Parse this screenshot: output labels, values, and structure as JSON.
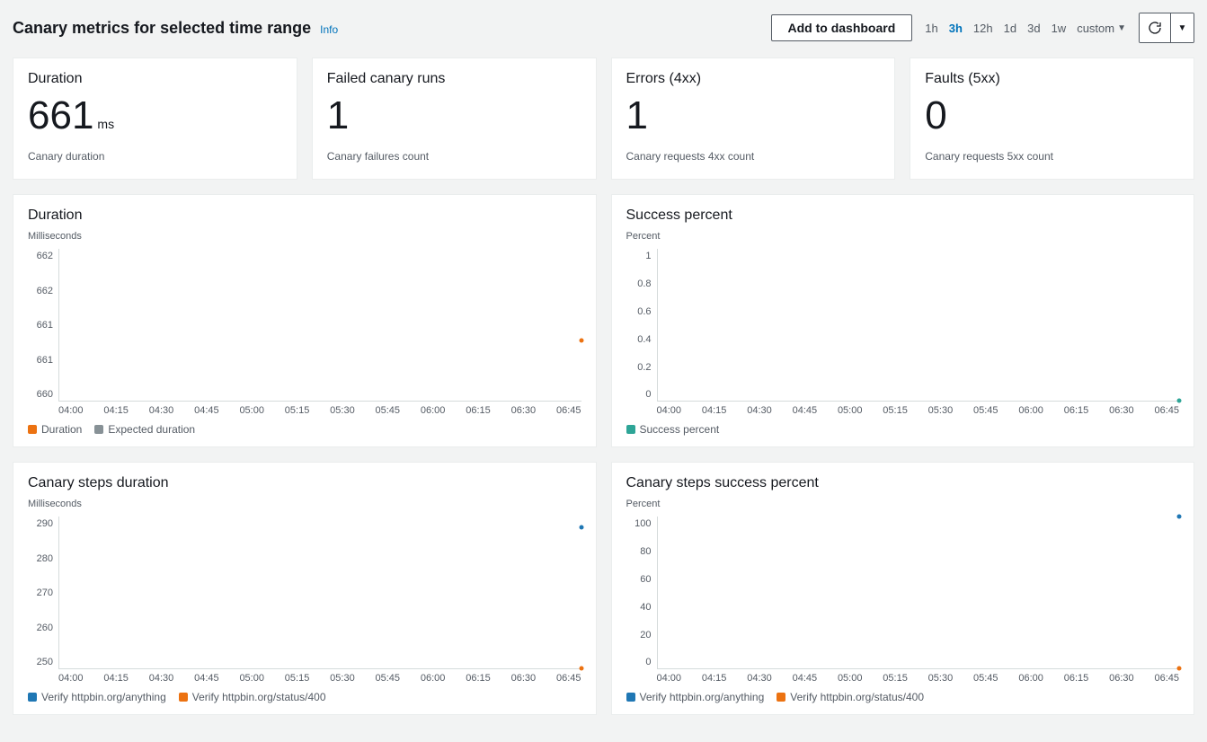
{
  "header": {
    "title": "Canary metrics for selected time range",
    "info": "Info",
    "add_dashboard": "Add to dashboard",
    "ranges": [
      "1h",
      "3h",
      "12h",
      "1d",
      "3d",
      "1w"
    ],
    "active_range": "3h",
    "custom": "custom"
  },
  "stats": [
    {
      "title": "Duration",
      "value": "661",
      "unit": "ms",
      "desc": "Canary duration"
    },
    {
      "title": "Failed canary runs",
      "value": "1",
      "unit": "",
      "desc": "Canary failures count"
    },
    {
      "title": "Errors (4xx)",
      "value": "1",
      "unit": "",
      "desc": "Canary requests 4xx count"
    },
    {
      "title": "Faults (5xx)",
      "value": "0",
      "unit": "",
      "desc": "Canary requests 5xx count"
    }
  ],
  "x_ticks": [
    "04:00",
    "04:15",
    "04:30",
    "04:45",
    "05:00",
    "05:15",
    "05:30",
    "05:45",
    "06:00",
    "06:15",
    "06:30",
    "06:45"
  ],
  "colors": {
    "orange": "#ec7211",
    "grey": "#879196",
    "teal": "#2ea597",
    "blue": "#1f77b4"
  },
  "charts": {
    "duration": {
      "title": "Duration",
      "ylabel": "Milliseconds",
      "yticks": [
        "662",
        "662",
        "661",
        "661",
        "660"
      ],
      "legend": [
        {
          "label": "Duration",
          "color": "orange"
        },
        {
          "label": "Expected duration",
          "color": "grey"
        }
      ]
    },
    "success": {
      "title": "Success percent",
      "ylabel": "Percent",
      "yticks": [
        "1",
        "0.8",
        "0.6",
        "0.4",
        "0.2",
        "0"
      ],
      "legend": [
        {
          "label": "Success percent",
          "color": "teal"
        }
      ]
    },
    "steps_duration": {
      "title": "Canary steps duration",
      "ylabel": "Milliseconds",
      "yticks": [
        "290",
        "280",
        "270",
        "260",
        "250"
      ],
      "legend": [
        {
          "label": "Verify httpbin.org/anything",
          "color": "blue"
        },
        {
          "label": "Verify httpbin.org/status/400",
          "color": "orange"
        }
      ]
    },
    "steps_success": {
      "title": "Canary steps success percent",
      "ylabel": "Percent",
      "yticks": [
        "100",
        "80",
        "60",
        "40",
        "20",
        "0"
      ],
      "legend": [
        {
          "label": "Verify httpbin.org/anything",
          "color": "blue"
        },
        {
          "label": "Verify httpbin.org/status/400",
          "color": "orange"
        }
      ]
    }
  },
  "chart_data": [
    {
      "id": "duration",
      "type": "scatter",
      "xlabel": "",
      "ylabel": "Milliseconds",
      "x": [
        "04:00",
        "04:15",
        "04:30",
        "04:45",
        "05:00",
        "05:15",
        "05:30",
        "05:45",
        "06:00",
        "06:15",
        "06:30",
        "06:45"
      ],
      "ylim": [
        660,
        662.5
      ],
      "series": [
        {
          "name": "Duration",
          "values": [
            null,
            null,
            null,
            null,
            null,
            null,
            null,
            null,
            null,
            null,
            null,
            661
          ]
        },
        {
          "name": "Expected duration",
          "values": [
            null,
            null,
            null,
            null,
            null,
            null,
            null,
            null,
            null,
            null,
            null,
            null
          ]
        }
      ]
    },
    {
      "id": "success",
      "type": "scatter",
      "xlabel": "",
      "ylabel": "Percent",
      "x": [
        "04:00",
        "04:15",
        "04:30",
        "04:45",
        "05:00",
        "05:15",
        "05:30",
        "05:45",
        "06:00",
        "06:15",
        "06:30",
        "06:45"
      ],
      "ylim": [
        0,
        1
      ],
      "series": [
        {
          "name": "Success percent",
          "values": [
            null,
            null,
            null,
            null,
            null,
            null,
            null,
            null,
            null,
            null,
            null,
            0
          ]
        }
      ]
    },
    {
      "id": "steps_duration",
      "type": "scatter",
      "xlabel": "",
      "ylabel": "Milliseconds",
      "x": [
        "04:00",
        "04:15",
        "04:30",
        "04:45",
        "05:00",
        "05:15",
        "05:30",
        "05:45",
        "06:00",
        "06:15",
        "06:30",
        "06:45"
      ],
      "ylim": [
        250,
        295
      ],
      "series": [
        {
          "name": "Verify httpbin.org/anything",
          "values": [
            null,
            null,
            null,
            null,
            null,
            null,
            null,
            null,
            null,
            null,
            null,
            292
          ]
        },
        {
          "name": "Verify httpbin.org/status/400",
          "values": [
            null,
            null,
            null,
            null,
            null,
            null,
            null,
            null,
            null,
            null,
            null,
            250
          ]
        }
      ]
    },
    {
      "id": "steps_success",
      "type": "scatter",
      "xlabel": "",
      "ylabel": "Percent",
      "x": [
        "04:00",
        "04:15",
        "04:30",
        "04:45",
        "05:00",
        "05:15",
        "05:30",
        "05:45",
        "06:00",
        "06:15",
        "06:30",
        "06:45"
      ],
      "ylim": [
        0,
        100
      ],
      "series": [
        {
          "name": "Verify httpbin.org/anything",
          "values": [
            null,
            null,
            null,
            null,
            null,
            null,
            null,
            null,
            null,
            null,
            null,
            100
          ]
        },
        {
          "name": "Verify httpbin.org/status/400",
          "values": [
            null,
            null,
            null,
            null,
            null,
            null,
            null,
            null,
            null,
            null,
            null,
            0
          ]
        }
      ]
    }
  ]
}
